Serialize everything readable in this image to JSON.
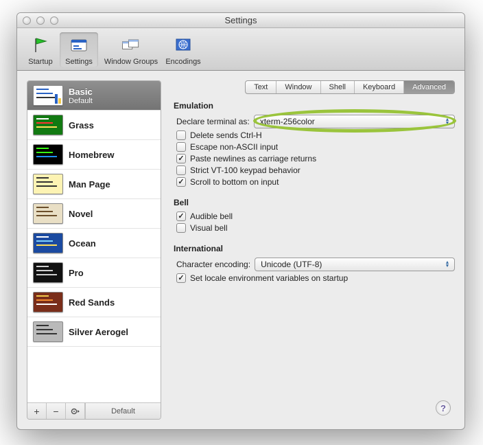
{
  "window": {
    "title": "Settings"
  },
  "toolbar": {
    "items": [
      {
        "label": "Startup"
      },
      {
        "label": "Settings"
      },
      {
        "label": "Window Groups"
      },
      {
        "label": "Encodings"
      }
    ],
    "active_index": 1
  },
  "sidebar": {
    "profiles": [
      {
        "name": "Basic",
        "sub": "Default",
        "thumb": {
          "bg": "#ffffff",
          "lines": [
            "#2a63c4",
            "#2a63c4",
            "#333"
          ],
          "bars": [
            "#f2c94c",
            "#2a63c4"
          ]
        }
      },
      {
        "name": "Grass",
        "thumb": {
          "bg": "#127a12",
          "lines": [
            "#fff",
            "#ff3333",
            "#ffde59"
          ]
        }
      },
      {
        "name": "Homebrew",
        "thumb": {
          "bg": "#000000",
          "lines": [
            "#39ff14",
            "#39ff14",
            "#1e90ff"
          ]
        }
      },
      {
        "name": "Man Page",
        "thumb": {
          "bg": "#fdf3b3",
          "lines": [
            "#333",
            "#333",
            "#333"
          ]
        }
      },
      {
        "name": "Novel",
        "thumb": {
          "bg": "#e9dfc5",
          "lines": [
            "#6b4f2a",
            "#6b4f2a",
            "#6b4f2a"
          ]
        }
      },
      {
        "name": "Ocean",
        "thumb": {
          "bg": "#1b4aa0",
          "lines": [
            "#fff",
            "#7fd3ff",
            "#ffde59"
          ]
        }
      },
      {
        "name": "Pro",
        "thumb": {
          "bg": "#111111",
          "lines": [
            "#d0d0d0",
            "#d0d0d0",
            "#d0d0d0"
          ]
        }
      },
      {
        "name": "Red Sands",
        "thumb": {
          "bg": "#7a2e1a",
          "lines": [
            "#f2c94c",
            "#f28b30",
            "#fff"
          ]
        }
      },
      {
        "name": "Silver Aerogel",
        "thumb": {
          "bg": "#b9b9b9",
          "lines": [
            "#333",
            "#333",
            "#333"
          ]
        }
      }
    ],
    "selected_index": 0,
    "footer": {
      "add": "+",
      "remove": "−",
      "gear": "*",
      "default_label": "Default"
    }
  },
  "tabs": {
    "items": [
      "Text",
      "Window",
      "Shell",
      "Keyboard",
      "Advanced"
    ],
    "active_index": 4
  },
  "sections": {
    "emulation": {
      "title": "Emulation",
      "declare_label": "Declare terminal as:",
      "declare_value": "xterm-256color",
      "options": [
        {
          "label": "Delete sends Ctrl-H",
          "checked": false
        },
        {
          "label": "Escape non-ASCII input",
          "checked": false
        },
        {
          "label": "Paste newlines as carriage returns",
          "checked": true
        },
        {
          "label": "Strict VT-100 keypad behavior",
          "checked": false
        },
        {
          "label": "Scroll to bottom on input",
          "checked": true
        }
      ]
    },
    "bell": {
      "title": "Bell",
      "options": [
        {
          "label": "Audible bell",
          "checked": true
        },
        {
          "label": "Visual bell",
          "checked": false
        }
      ]
    },
    "international": {
      "title": "International",
      "encoding_label": "Character encoding:",
      "encoding_value": "Unicode (UTF-8)",
      "locale": {
        "label": "Set locale environment variables on startup",
        "checked": true
      }
    }
  },
  "help_glyph": "?"
}
